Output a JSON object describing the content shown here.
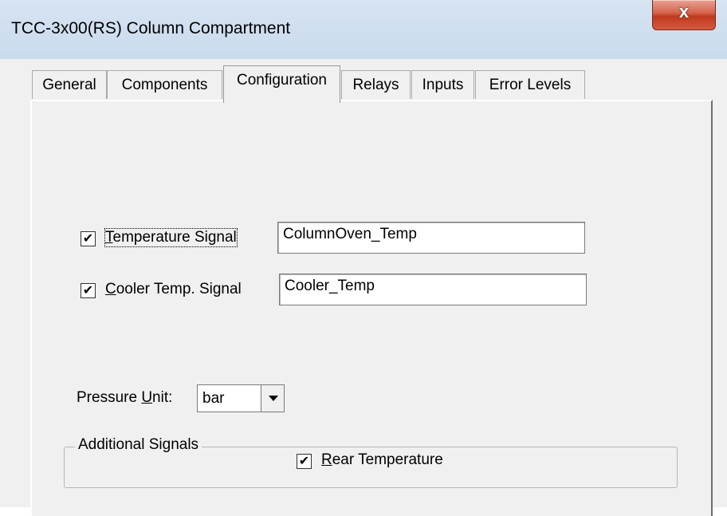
{
  "window": {
    "title": "TCC-3x00(RS) Column Compartment",
    "close_glyph": "x"
  },
  "tabs": [
    {
      "label": "General",
      "active": false
    },
    {
      "label": "Components",
      "active": false
    },
    {
      "label": "Configuration",
      "active": true
    },
    {
      "label": "Relays",
      "active": false
    },
    {
      "label": "Inputs",
      "active": false
    },
    {
      "label": "Error Levels",
      "active": false
    }
  ],
  "signals": {
    "temperature": {
      "checked": true,
      "check_mark": "✔",
      "access_key": "T",
      "label_rest": "emperature Signal",
      "value": "ColumnOven_Temp"
    },
    "cooler": {
      "checked": true,
      "check_mark": "✔",
      "access_key": "C",
      "label_rest": "ooler Temp. Signal",
      "value": "Cooler_Temp"
    }
  },
  "pressure": {
    "label_before": "Pressure ",
    "access_key": "U",
    "label_after": "nit:",
    "selected": "bar"
  },
  "additional": {
    "group_label": "Additional Signals",
    "rear": {
      "checked": true,
      "check_mark": "✔",
      "access_key": "R",
      "label_rest": "ear Temperature"
    }
  }
}
